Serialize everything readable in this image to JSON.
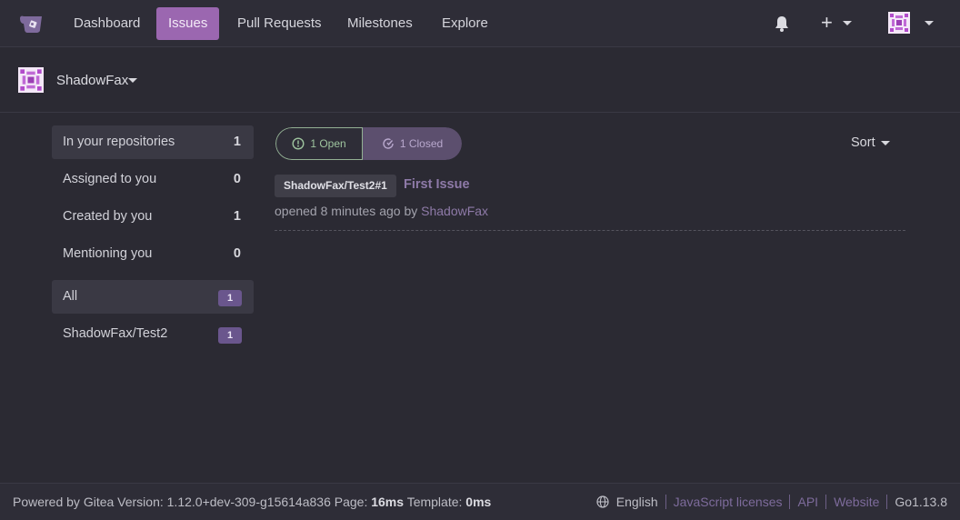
{
  "nav": {
    "items": [
      {
        "label": "Dashboard"
      },
      {
        "label": "Issues"
      },
      {
        "label": "Pull Requests"
      },
      {
        "label": "Milestones"
      },
      {
        "label": "Explore"
      }
    ],
    "active": "Issues",
    "plus_label": "+",
    "icons": [
      "gitea-logo-icon",
      "bell-icon",
      "plus-icon",
      "avatar"
    ]
  },
  "context": {
    "user": "ShadowFax"
  },
  "sidebar": {
    "filters": [
      {
        "label": "In your repositories",
        "count": "1"
      },
      {
        "label": "Assigned to you",
        "count": "0"
      },
      {
        "label": "Created by you",
        "count": "1"
      },
      {
        "label": "Mentioning you",
        "count": "0"
      }
    ],
    "repos": [
      {
        "label": "All",
        "count": "1"
      },
      {
        "label": "ShadowFax/Test2",
        "count": "1"
      }
    ]
  },
  "issues": {
    "open_label": "1 Open",
    "closed_label": "1 Closed",
    "sort_label": "Sort",
    "list": [
      {
        "repo": "ShadowFax/Test2#1",
        "title": "First Issue",
        "meta_prefix": "opened 8 minutes ago by",
        "author": "ShadowFax"
      }
    ]
  },
  "footer": {
    "powered": "Powered by Gitea Version: 1.12.0+dev-309-g15614a836 Page:",
    "page_time": "16ms",
    "template_prefix": "Template:",
    "template_time": "0ms",
    "language": "English",
    "links": [
      "JavaScript licenses",
      "API",
      "Website"
    ],
    "go_version": "Go1.13.8"
  },
  "colors": {
    "accent": "#9b67b0",
    "link": "#8e7aa8",
    "badge": "#6a568d",
    "open_green": "#9fc59f",
    "background": "#2b2a33"
  }
}
